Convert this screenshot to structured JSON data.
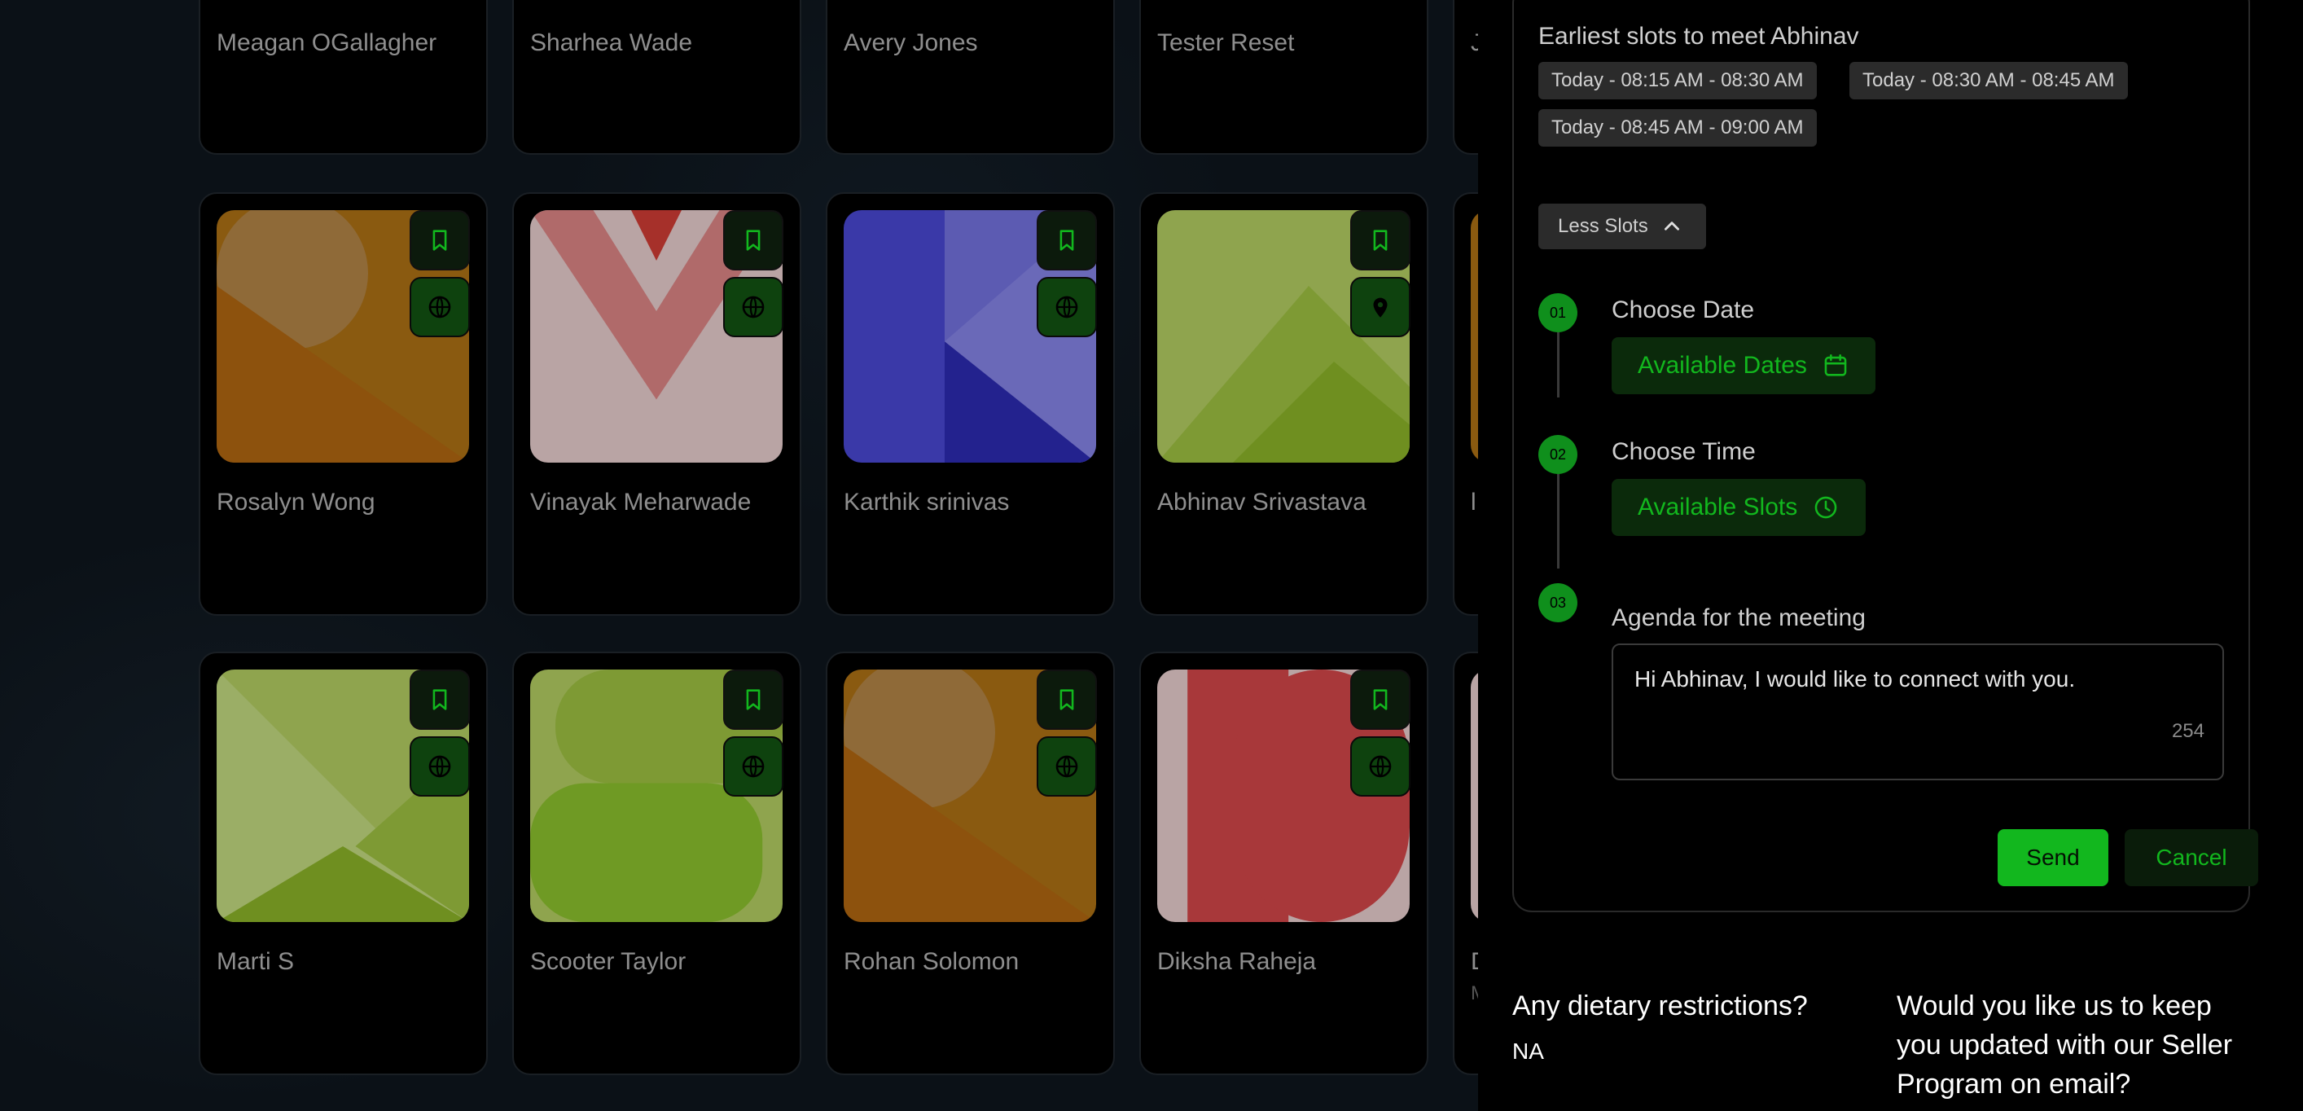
{
  "people_top_row": [
    {
      "name": "Meagan OGallagher"
    },
    {
      "name": "Sharhea Wade"
    },
    {
      "name": "Avery Jones"
    },
    {
      "name": "Tester Reset"
    },
    {
      "name": "J"
    }
  ],
  "people_mid_row": [
    {
      "name": "Rosalyn Wong",
      "action_icon": "globe-icon"
    },
    {
      "name": "Vinayak Meharwade",
      "action_icon": "globe-icon"
    },
    {
      "name": "Karthik srinivas",
      "action_icon": "globe-icon"
    },
    {
      "name": "Abhinav Srivastava",
      "action_icon": "location-pin-icon"
    },
    {
      "name": "l"
    }
  ],
  "people_bottom_row": [
    {
      "name": "Marti S",
      "action_icon": "globe-icon"
    },
    {
      "name": "Scooter Taylor",
      "action_icon": "globe-icon"
    },
    {
      "name": "Rohan Solomon",
      "action_icon": "globe-icon"
    },
    {
      "name": "Diksha Raheja",
      "action_icon": "globe-icon"
    },
    {
      "name": "D",
      "sub": "M"
    }
  ],
  "scheduler": {
    "title": "Earliest slots to meet Abhinav",
    "slots": [
      "Today - 08:15 AM - 08:30 AM",
      "Today - 08:30 AM - 08:45 AM",
      "Today - 08:45 AM - 09:00 AM"
    ],
    "less_slots_label": "Less Slots",
    "steps": [
      {
        "number": "01",
        "label": "Choose Date",
        "button": "Available Dates",
        "icon": "calendar-icon"
      },
      {
        "number": "02",
        "label": "Choose Time",
        "button": "Available Slots",
        "icon": "clock-icon"
      },
      {
        "number": "03",
        "label": "Agenda for the meeting"
      }
    ],
    "agenda_text": "Hi  Abhinav, I would like to connect with you.",
    "agenda_remaining": "254",
    "send_label": "Send",
    "cancel_label": "Cancel"
  },
  "questions": [
    {
      "question": "Any dietary restrictions?",
      "answer": "NA"
    },
    {
      "question": "Would you like us to keep you updated with our Seller Program on email?",
      "answer": ""
    }
  ],
  "colors": {
    "accent_green": "#12b71e",
    "panel_bg": "#000000",
    "chip_bg": "#2b2b2b"
  }
}
